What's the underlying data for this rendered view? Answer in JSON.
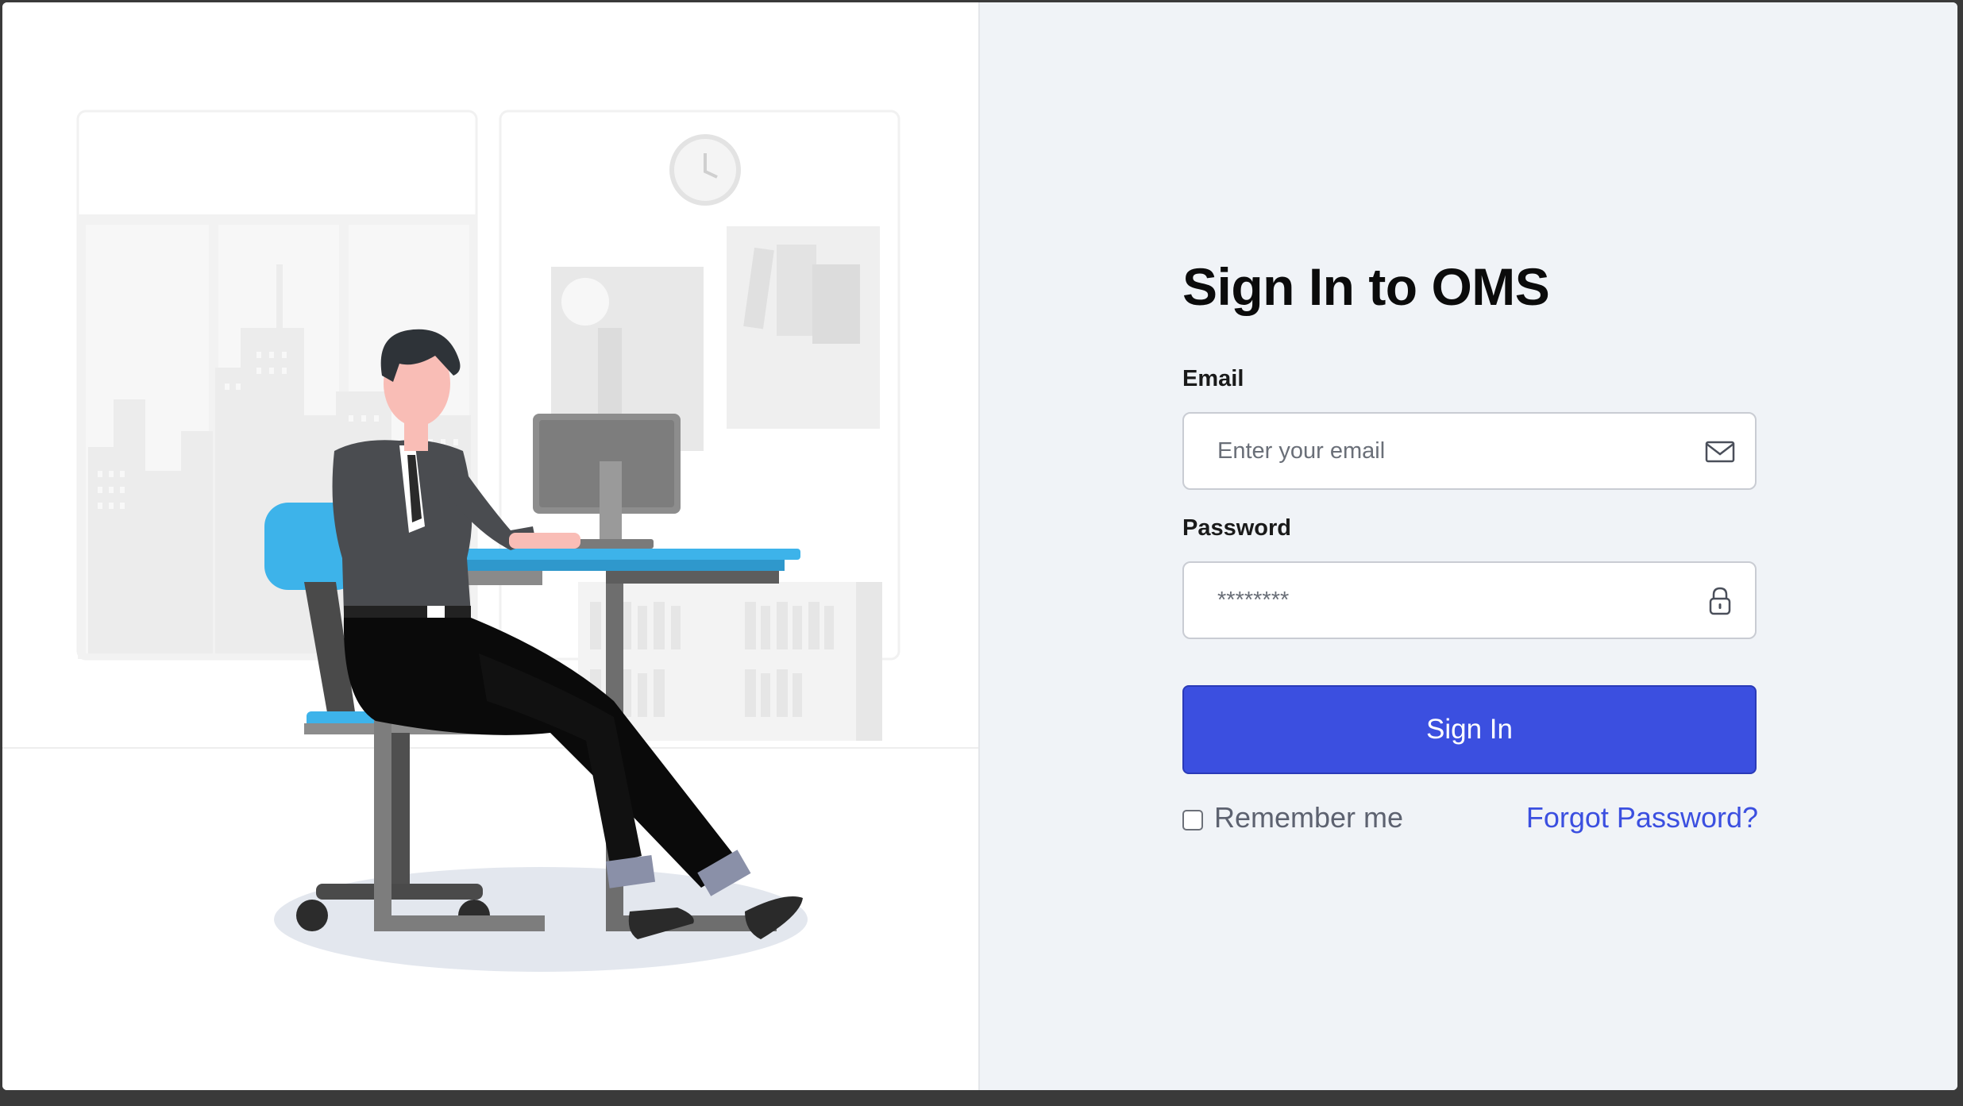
{
  "login": {
    "title": "Sign In to OMS",
    "email": {
      "label": "Email",
      "placeholder": "Enter your email",
      "value": "",
      "icon": "mail-icon"
    },
    "password": {
      "label": "Password",
      "placeholder": "********",
      "value": "",
      "icon": "lock-icon"
    },
    "submit_label": "Sign In",
    "remember_label": "Remember me",
    "remember_checked": false,
    "forgot_label": "Forgot Password?"
  },
  "colors": {
    "primary": "#3b4fe0",
    "panel_bg": "#f0f3f7",
    "chair_blue": "#3db3ea"
  }
}
